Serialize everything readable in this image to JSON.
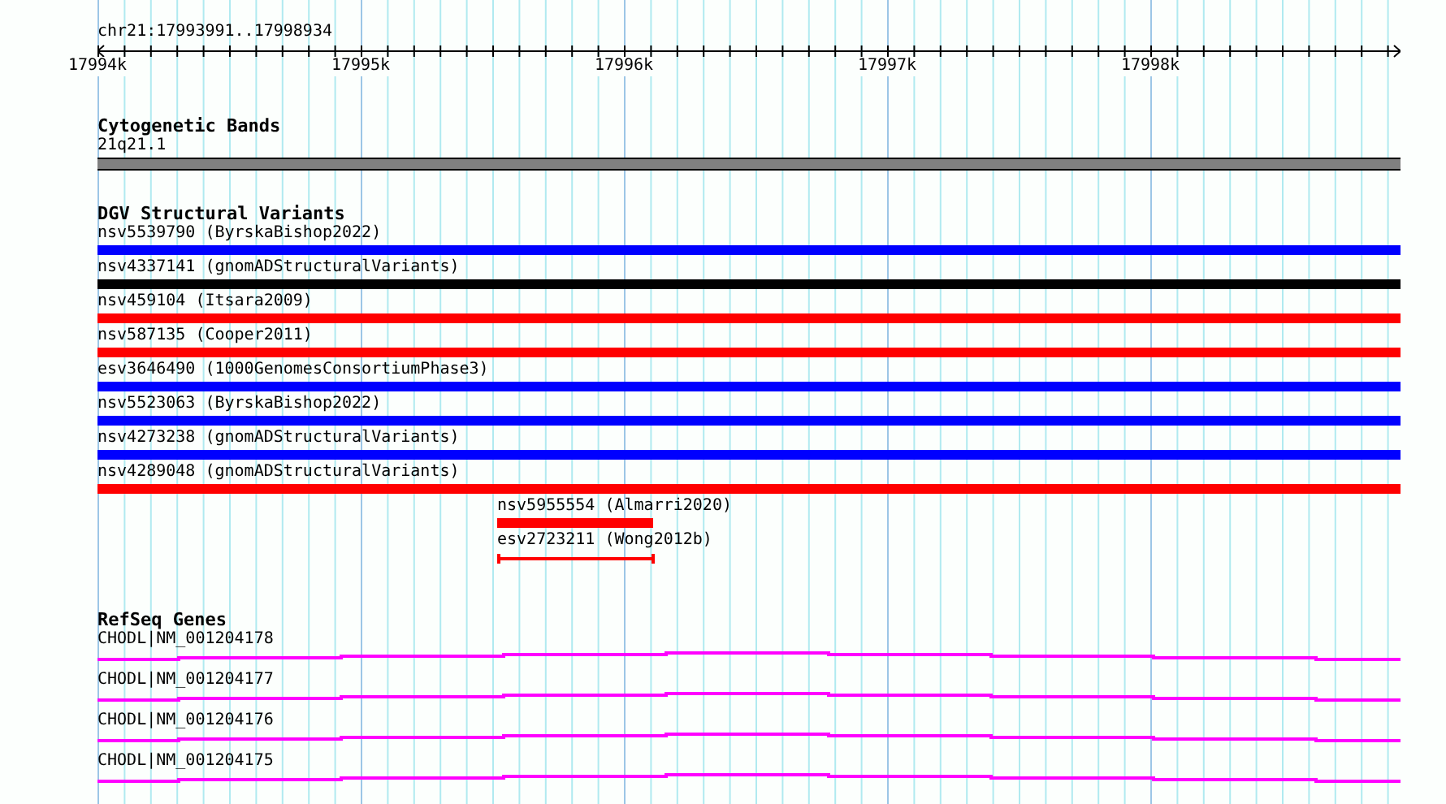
{
  "location": "chr21:17993991..17998934",
  "ruler": {
    "ticks": [
      "17994k",
      "17995k",
      "17996k",
      "17997k",
      "17998k"
    ]
  },
  "tracks": [
    {
      "kind": "bands",
      "title": "Cytogenetic Bands",
      "features": [
        {
          "label": "21q21.1"
        }
      ]
    },
    {
      "kind": "variants",
      "title": "DGV Structural Variants",
      "features": [
        {
          "label": "nsv5539790 (ByrskaBishop2022)",
          "color": "#0000ff",
          "kind": "bar"
        },
        {
          "label": "nsv4337141 (gnomADStructuralVariants)",
          "color": "#000000",
          "kind": "bar"
        },
        {
          "label": "nsv459104 (Itsara2009)",
          "color": "#ff0000",
          "kind": "bar"
        },
        {
          "label": "nsv587135 (Cooper2011)",
          "color": "#ff0000",
          "kind": "bar"
        },
        {
          "label": "esv3646490 (1000GenomesConsortiumPhase3)",
          "color": "#0000ff",
          "kind": "bar"
        },
        {
          "label": "nsv5523063 (ByrskaBishop2022)",
          "color": "#0000ff",
          "kind": "bar"
        },
        {
          "label": "nsv4273238 (gnomADStructuralVariants)",
          "color": "#0000ff",
          "kind": "bar"
        },
        {
          "label": "nsv4289048 (gnomADStructuralVariants)",
          "color": "#ff0000",
          "kind": "bar"
        },
        {
          "label": "nsv5955554 (Almarri2020)",
          "color": "#ff0000",
          "kind": "short_bar"
        },
        {
          "label": "esv2723211 (Wong2012b)",
          "color": "#ff0000",
          "kind": "range"
        }
      ]
    },
    {
      "kind": "genes",
      "title": "RefSeq Genes",
      "features": [
        {
          "label": "CHODL|NM_001204178"
        },
        {
          "label": "CHODL|NM_001204177"
        },
        {
          "label": "CHODL|NM_001204176"
        },
        {
          "label": "CHODL|NM_001204175"
        }
      ]
    }
  ]
}
